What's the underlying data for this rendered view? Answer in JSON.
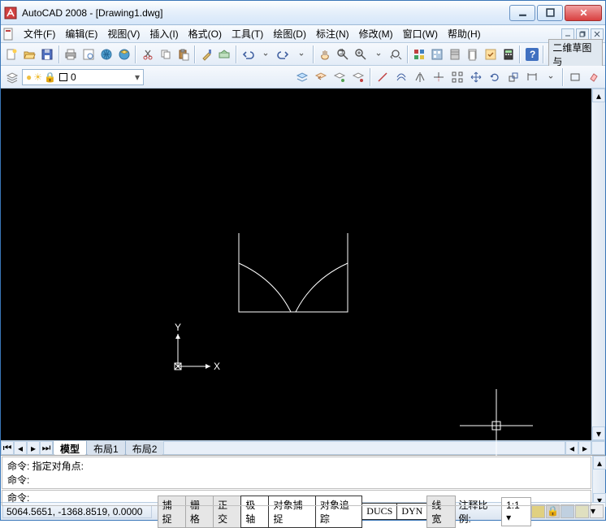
{
  "title": "AutoCAD 2008 - [Drawing1.dwg]",
  "menu": [
    "文件(F)",
    "编辑(E)",
    "视图(V)",
    "插入(I)",
    "格式(O)",
    "工具(T)",
    "绘图(D)",
    "标注(N)",
    "修改(M)",
    "窗口(W)",
    "帮助(H)"
  ],
  "layer": {
    "name": "0"
  },
  "panel_right_text": "二维草图与",
  "tabs": [
    "模型",
    "布局1",
    "布局2"
  ],
  "active_tab": 0,
  "cmd_history": [
    "命令: 指定对角点:",
    "命令:"
  ],
  "cmd_prompt": "命令:",
  "coords": "5064.5651, -1368.8519, 0.0000",
  "status_buttons": [
    "捕捉",
    "栅格",
    "正交",
    "极轴",
    "对象捕捉",
    "对象追踪",
    "DUCS",
    "DYN",
    "线宽"
  ],
  "status_active": [
    "极轴",
    "对象捕捉",
    "对象追踪",
    "DUCS",
    "DYN"
  ],
  "annot_label": "注释比例:",
  "annot_scale": "1:1",
  "ucs": {
    "x": "X",
    "y": "Y"
  }
}
